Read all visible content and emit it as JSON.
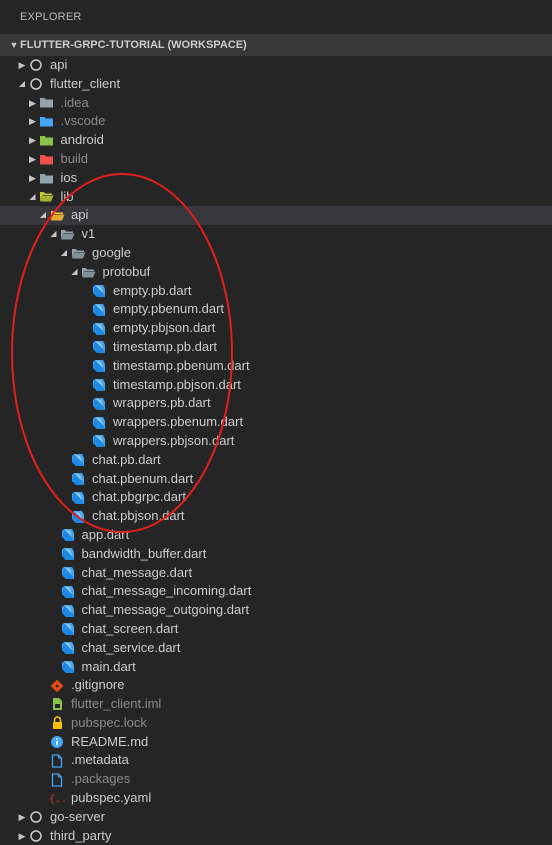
{
  "explorer": {
    "title": "EXPLORER"
  },
  "workspace": {
    "title": "FLUTTER-GRPC-TUTORIAL (WORKSPACE)"
  },
  "tree": [
    {
      "label": "api",
      "depth": 0,
      "twisty": "closed",
      "icon": "circle-icon",
      "kind": "root"
    },
    {
      "label": "flutter_client",
      "depth": 0,
      "twisty": "open",
      "icon": "circle-icon",
      "kind": "root"
    },
    {
      "label": ".idea",
      "depth": 1,
      "twisty": "closed",
      "icon": "folder-icon",
      "color": "#90a4ae",
      "dim": true
    },
    {
      "label": ".vscode",
      "depth": 1,
      "twisty": "closed",
      "icon": "folder-vscode-icon",
      "color": "#42a5f5",
      "dim": true
    },
    {
      "label": "android",
      "depth": 1,
      "twisty": "closed",
      "icon": "folder-android-icon",
      "color": "#8bc34a"
    },
    {
      "label": "build",
      "depth": 1,
      "twisty": "closed",
      "icon": "folder-build-icon",
      "color": "#ef5350",
      "dim": true
    },
    {
      "label": "ios",
      "depth": 1,
      "twisty": "closed",
      "icon": "folder-ios-icon",
      "color": "#90a4ae"
    },
    {
      "label": "lib",
      "depth": 1,
      "twisty": "open",
      "icon": "folder-open-lib-icon",
      "color": "#c0ca33"
    },
    {
      "label": "api",
      "depth": 2,
      "twisty": "open",
      "icon": "folder-open-api-icon",
      "color": "#fbc02d",
      "selected": true
    },
    {
      "label": "v1",
      "depth": 3,
      "twisty": "open",
      "icon": "folder-open-icon",
      "color": "#90a4ae"
    },
    {
      "label": "google",
      "depth": 4,
      "twisty": "open",
      "icon": "folder-open-icon",
      "color": "#90a4ae"
    },
    {
      "label": "protobuf",
      "depth": 5,
      "twisty": "open",
      "icon": "folder-open-icon",
      "color": "#90a4ae"
    },
    {
      "label": "empty.pb.dart",
      "depth": 6,
      "twisty": "none",
      "icon": "dart-icon"
    },
    {
      "label": "empty.pbenum.dart",
      "depth": 6,
      "twisty": "none",
      "icon": "dart-icon"
    },
    {
      "label": "empty.pbjson.dart",
      "depth": 6,
      "twisty": "none",
      "icon": "dart-icon"
    },
    {
      "label": "timestamp.pb.dart",
      "depth": 6,
      "twisty": "none",
      "icon": "dart-icon"
    },
    {
      "label": "timestamp.pbenum.dart",
      "depth": 6,
      "twisty": "none",
      "icon": "dart-icon"
    },
    {
      "label": "timestamp.pbjson.dart",
      "depth": 6,
      "twisty": "none",
      "icon": "dart-icon"
    },
    {
      "label": "wrappers.pb.dart",
      "depth": 6,
      "twisty": "none",
      "icon": "dart-icon"
    },
    {
      "label": "wrappers.pbenum.dart",
      "depth": 6,
      "twisty": "none",
      "icon": "dart-icon"
    },
    {
      "label": "wrappers.pbjson.dart",
      "depth": 6,
      "twisty": "none",
      "icon": "dart-icon"
    },
    {
      "label": "chat.pb.dart",
      "depth": 4,
      "twisty": "none",
      "icon": "dart-icon"
    },
    {
      "label": "chat.pbenum.dart",
      "depth": 4,
      "twisty": "none",
      "icon": "dart-icon"
    },
    {
      "label": "chat.pbgrpc.dart",
      "depth": 4,
      "twisty": "none",
      "icon": "dart-icon"
    },
    {
      "label": "chat.pbjson.dart",
      "depth": 4,
      "twisty": "none",
      "icon": "dart-icon"
    },
    {
      "label": "app.dart",
      "depth": 3,
      "twisty": "none",
      "icon": "dart-icon"
    },
    {
      "label": "bandwidth_buffer.dart",
      "depth": 3,
      "twisty": "none",
      "icon": "dart-icon"
    },
    {
      "label": "chat_message.dart",
      "depth": 3,
      "twisty": "none",
      "icon": "dart-icon"
    },
    {
      "label": "chat_message_incoming.dart",
      "depth": 3,
      "twisty": "none",
      "icon": "dart-icon"
    },
    {
      "label": "chat_message_outgoing.dart",
      "depth": 3,
      "twisty": "none",
      "icon": "dart-icon"
    },
    {
      "label": "chat_screen.dart",
      "depth": 3,
      "twisty": "none",
      "icon": "dart-icon"
    },
    {
      "label": "chat_service.dart",
      "depth": 3,
      "twisty": "none",
      "icon": "dart-icon"
    },
    {
      "label": "main.dart",
      "depth": 3,
      "twisty": "none",
      "icon": "dart-icon"
    },
    {
      "label": ".gitignore",
      "depth": 2,
      "twisty": "none",
      "icon": "git-icon",
      "color": "#e64a19"
    },
    {
      "label": "flutter_client.iml",
      "depth": 2,
      "twisty": "none",
      "icon": "iml-icon",
      "color": "#8bc34a",
      "dim": true
    },
    {
      "label": "pubspec.lock",
      "depth": 2,
      "twisty": "none",
      "icon": "lock-icon",
      "color": "#ffc107",
      "dim": true
    },
    {
      "label": "README.md",
      "depth": 2,
      "twisty": "none",
      "icon": "info-icon",
      "color": "#42a5f5"
    },
    {
      "label": ".metadata",
      "depth": 2,
      "twisty": "none",
      "icon": "file-icon",
      "color": "#42a5f5"
    },
    {
      "label": ".packages",
      "depth": 2,
      "twisty": "none",
      "icon": "file-icon",
      "color": "#42a5f5",
      "dim": true
    },
    {
      "label": "pubspec.yaml",
      "depth": 2,
      "twisty": "none",
      "icon": "yaml-icon",
      "color": "#e53935"
    },
    {
      "label": "go-server",
      "depth": 0,
      "twisty": "closed",
      "icon": "circle-icon",
      "kind": "root"
    },
    {
      "label": "third_party",
      "depth": 0,
      "twisty": "closed",
      "icon": "circle-icon",
      "kind": "root"
    }
  ],
  "annotation": {
    "color": "#e0201c"
  }
}
